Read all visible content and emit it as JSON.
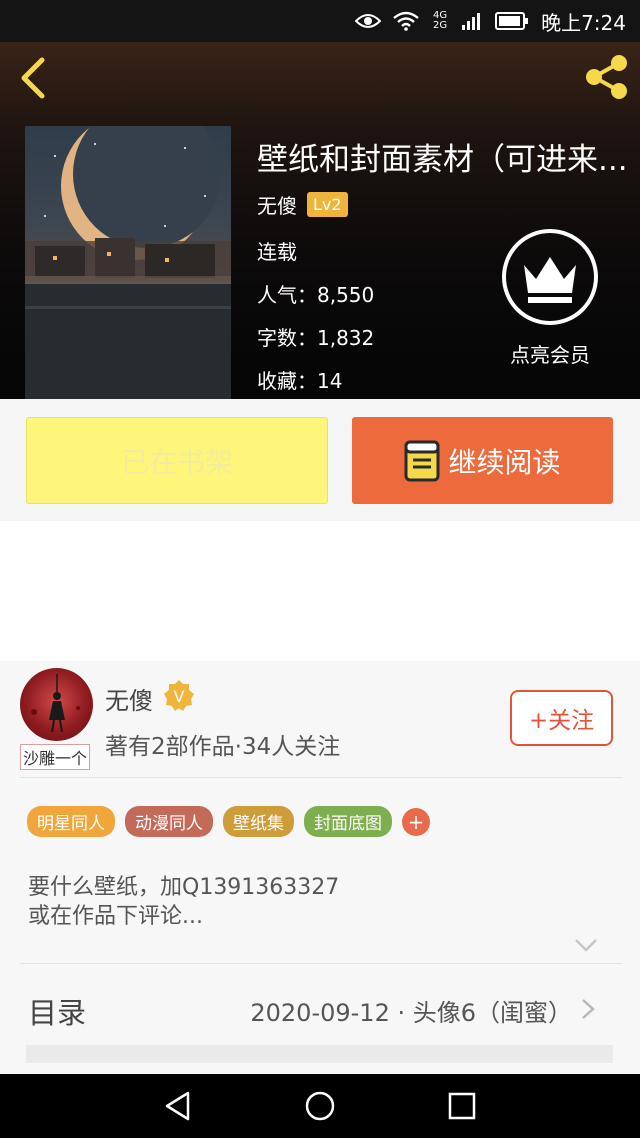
{
  "status_bar": {
    "network": "4G 2G",
    "time": "晚上7:24"
  },
  "book": {
    "title": "壁纸和封面素材（可进来...",
    "author": "无傻",
    "level": "Lv2",
    "status": "连载",
    "popularity": "人气：8,550",
    "word_count": "字数：1,832",
    "favorites": "收藏：14"
  },
  "vip": {
    "label": "点亮会员"
  },
  "actions": {
    "shelf_label": "已在书架",
    "read_label": "继续阅读"
  },
  "author_card": {
    "name": "无傻",
    "verified_badge": "V",
    "avatar_tag": "沙雕一个",
    "stats": "著有2部作品·34人关注",
    "follow_label": "+关注"
  },
  "tags": [
    {
      "label": "明星同人",
      "color": "#f0a63a"
    },
    {
      "label": "动漫同人",
      "color": "#c46a58"
    },
    {
      "label": "壁纸集",
      "color": "#cf9c3a"
    },
    {
      "label": "封面底图",
      "color": "#7eae4e"
    }
  ],
  "tag_add_label": "+",
  "description": {
    "line1": "要什么壁纸，加Q1391363327",
    "line2": "或在作品下评论..."
  },
  "toc": {
    "label": "目录",
    "latest": "2020-09-12 · 头像6（闺蜜）"
  },
  "icons": {
    "back": "chevron-left-icon",
    "share": "share-icon",
    "crown": "crown-icon",
    "book": "book-icon",
    "expand": "chevron-down-icon",
    "toc": "chevron-right-icon"
  },
  "colors": {
    "accent_yellow": "#f5d94a",
    "read_button": "#ec6a3c",
    "shelf_button": "#fef67a",
    "follow": "#e2553d",
    "level_badge": "#f0b43c"
  }
}
